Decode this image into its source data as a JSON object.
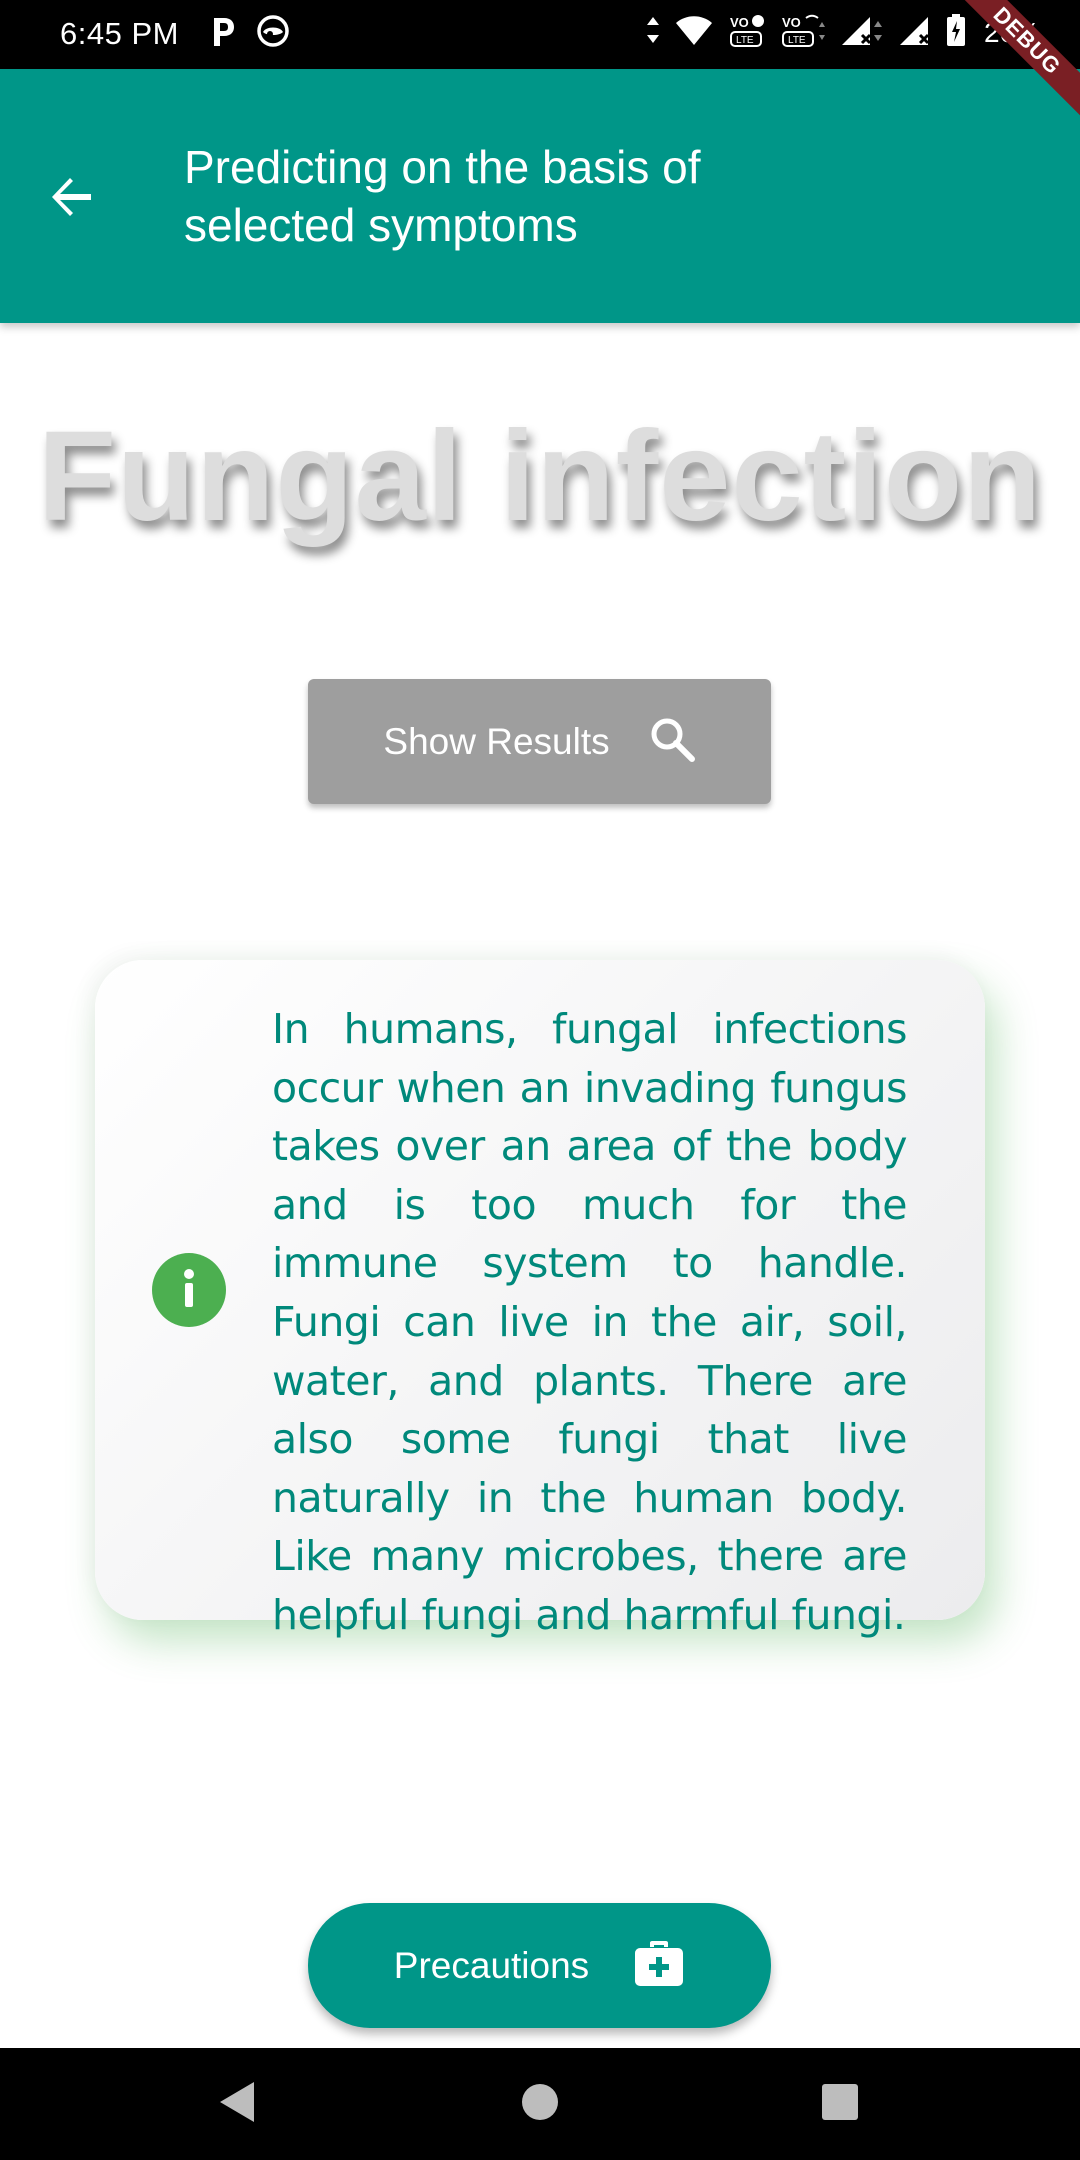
{
  "status_bar": {
    "time": "6:45 PM",
    "battery": "26%",
    "left_icons": [
      "parking-app-icon",
      "incognito-icon"
    ],
    "right_icons": [
      "data-arrows-icon",
      "wifi-icon",
      "volte-1-icon",
      "vowifi-lte-icon",
      "signal-1-icon",
      "signal-2-icon",
      "battery-icon"
    ]
  },
  "debug_banner": "DEBUG",
  "app_bar": {
    "back_icon": "arrow-back-icon",
    "title": "Predicting on the basis of selected symptoms"
  },
  "prediction": {
    "disease": "Fungal infection"
  },
  "show_results_button": {
    "label": "Show Results",
    "icon": "search-icon"
  },
  "info_card": {
    "icon": "info-icon",
    "text": "In humans, fungal infections occur when an invading fungus takes over an area of the body and is too much for the immune system to handle. Fungi can live in the air, soil, water, and plants. There are also some fungi that live naturally in the human body. Like many microbes, there are helpful fungi and harmful fungi."
  },
  "precautions_button": {
    "label": "Precautions",
    "icon": "medical-kit-icon"
  },
  "nav_bar": {
    "buttons": [
      "back-triangle-icon",
      "home-circle-icon",
      "recents-square-icon"
    ]
  },
  "colors": {
    "primary": "#009688",
    "info_text": "#00897b",
    "info_icon": "#4caf50",
    "disabled_button": "#9e9e9e",
    "heading": "#dddddd"
  }
}
